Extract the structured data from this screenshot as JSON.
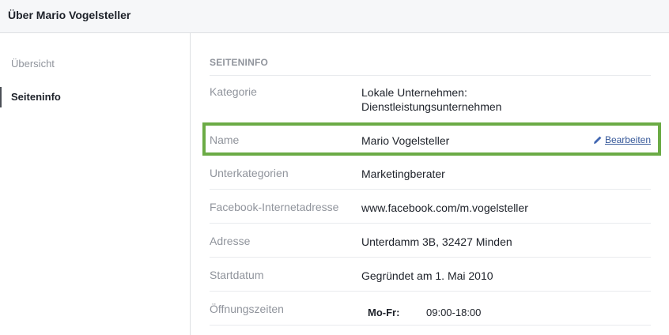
{
  "header": {
    "title": "Über Mario Vogelsteller"
  },
  "sidebar": {
    "items": [
      {
        "label": "Übersicht",
        "active": false
      },
      {
        "label": "Seiteninfo",
        "active": true
      }
    ]
  },
  "section": {
    "title": "SEITENINFO"
  },
  "rows": [
    {
      "label": "Kategorie",
      "value_line1": "Lokale Unternehmen:",
      "value_line2": "Dienstleistungsunternehmen"
    },
    {
      "label": "Name",
      "value": "Mario Vogelsteller",
      "edit_label": "Bearbeiten",
      "edit_icon": "pencil-icon"
    },
    {
      "label": "Unterkategorien",
      "value": "Marketingberater"
    },
    {
      "label": "Facebook-Internetadresse",
      "value": "www.facebook.com/m.vogelsteller"
    },
    {
      "label": "Adresse",
      "value": "Unterdamm 3B, 32427 Minden"
    },
    {
      "label": "Startdatum",
      "value": "Gegründet am 1. Mai 2010"
    },
    {
      "label": "Öffnungszeiten",
      "hours": [
        {
          "days": "Mo-Fr:",
          "time": "09:00-18:00"
        }
      ]
    }
  ],
  "colors": {
    "highlight_border": "#6bab45",
    "link": "#365899",
    "muted_text": "#90949c"
  }
}
